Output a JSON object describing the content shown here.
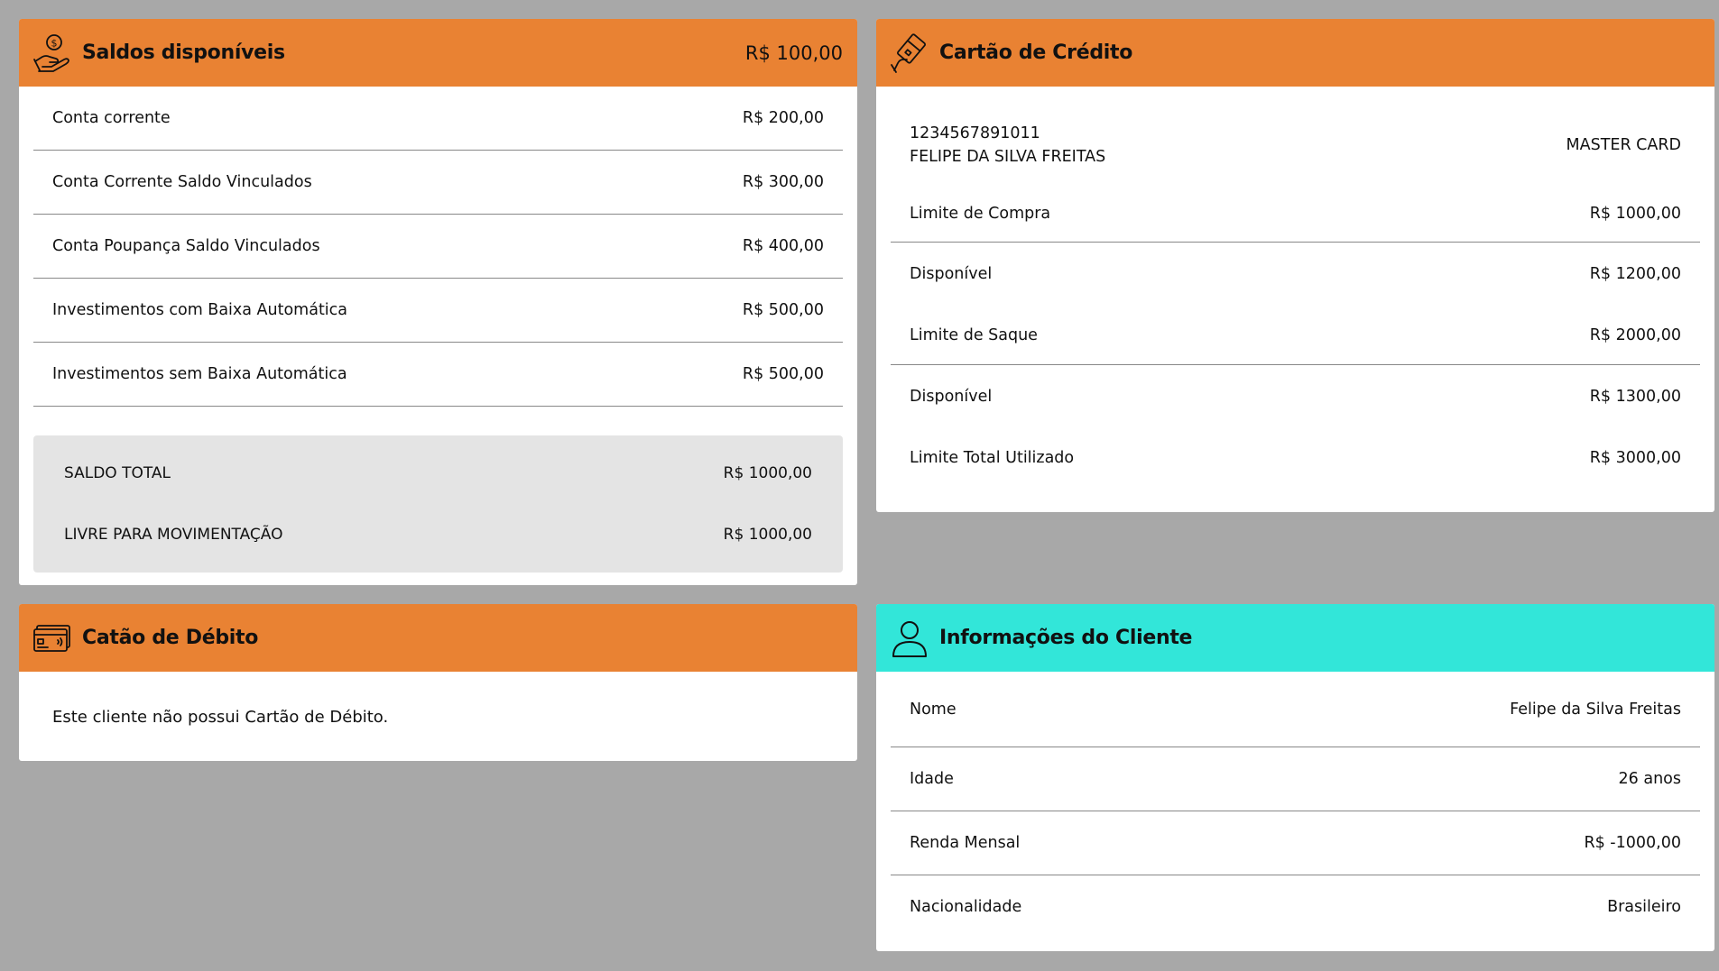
{
  "saldos": {
    "title": "Saldos disponíveis",
    "header_value": "R$ 100,00",
    "icon": "hand-coin-icon",
    "rows": [
      {
        "label": "Conta corrente",
        "value": "R$ 200,00"
      },
      {
        "label": "Conta Corrente Saldo Vinculados",
        "value": "R$ 300,00"
      },
      {
        "label": "Conta Poupança Saldo Vinculados",
        "value": "R$ 400,00"
      },
      {
        "label": "Investimentos com Baixa Automática",
        "value": "R$ 500,00"
      },
      {
        "label": "Investimentos sem Baixa Automática",
        "value": "R$ 500,00"
      }
    ],
    "totals": [
      {
        "label": "SALDO TOTAL",
        "value": "R$ 1000,00"
      },
      {
        "label": "LIVRE PARA MOVIMENTAÇÃO",
        "value": "R$ 1000,00"
      }
    ]
  },
  "credito": {
    "title": "Cartão de Crédito",
    "icon": "credit-card-hand-icon",
    "card_number": "1234567891011",
    "holder": "FELIPE DA SILVA FREITAS",
    "brand": "MASTER CARD",
    "rows": [
      {
        "label": "Limite de Compra",
        "value": "R$ 1000,00"
      },
      {
        "label": "Disponível",
        "value": "R$ 1200,00"
      },
      {
        "label": "Limite de Saque",
        "value": "R$ 2000,00"
      },
      {
        "label": "Disponível",
        "value": "R$ 1300,00"
      },
      {
        "label": "Limite Total Utilizado",
        "value": "R$ 3000,00"
      }
    ]
  },
  "debito": {
    "title": "Catão de Débito",
    "icon": "debit-card-icon",
    "message": "Este cliente não possui Cartão de Débito."
  },
  "cliente": {
    "title": "Informações do Cliente",
    "icon": "user-icon",
    "rows": [
      {
        "label": "Nome",
        "value": "Felipe da Silva Freitas"
      },
      {
        "label": "Idade",
        "value": "26 anos"
      },
      {
        "label": "Renda Mensal",
        "value": "R$ -1000,00"
      },
      {
        "label": "Nacionalidade",
        "value": "Brasileiro"
      }
    ]
  },
  "colors": {
    "page_bg": "#a8a8a8",
    "header_orange": "#e98233",
    "header_cyan": "#32e6d9",
    "totals_bg": "#e4e4e4"
  }
}
